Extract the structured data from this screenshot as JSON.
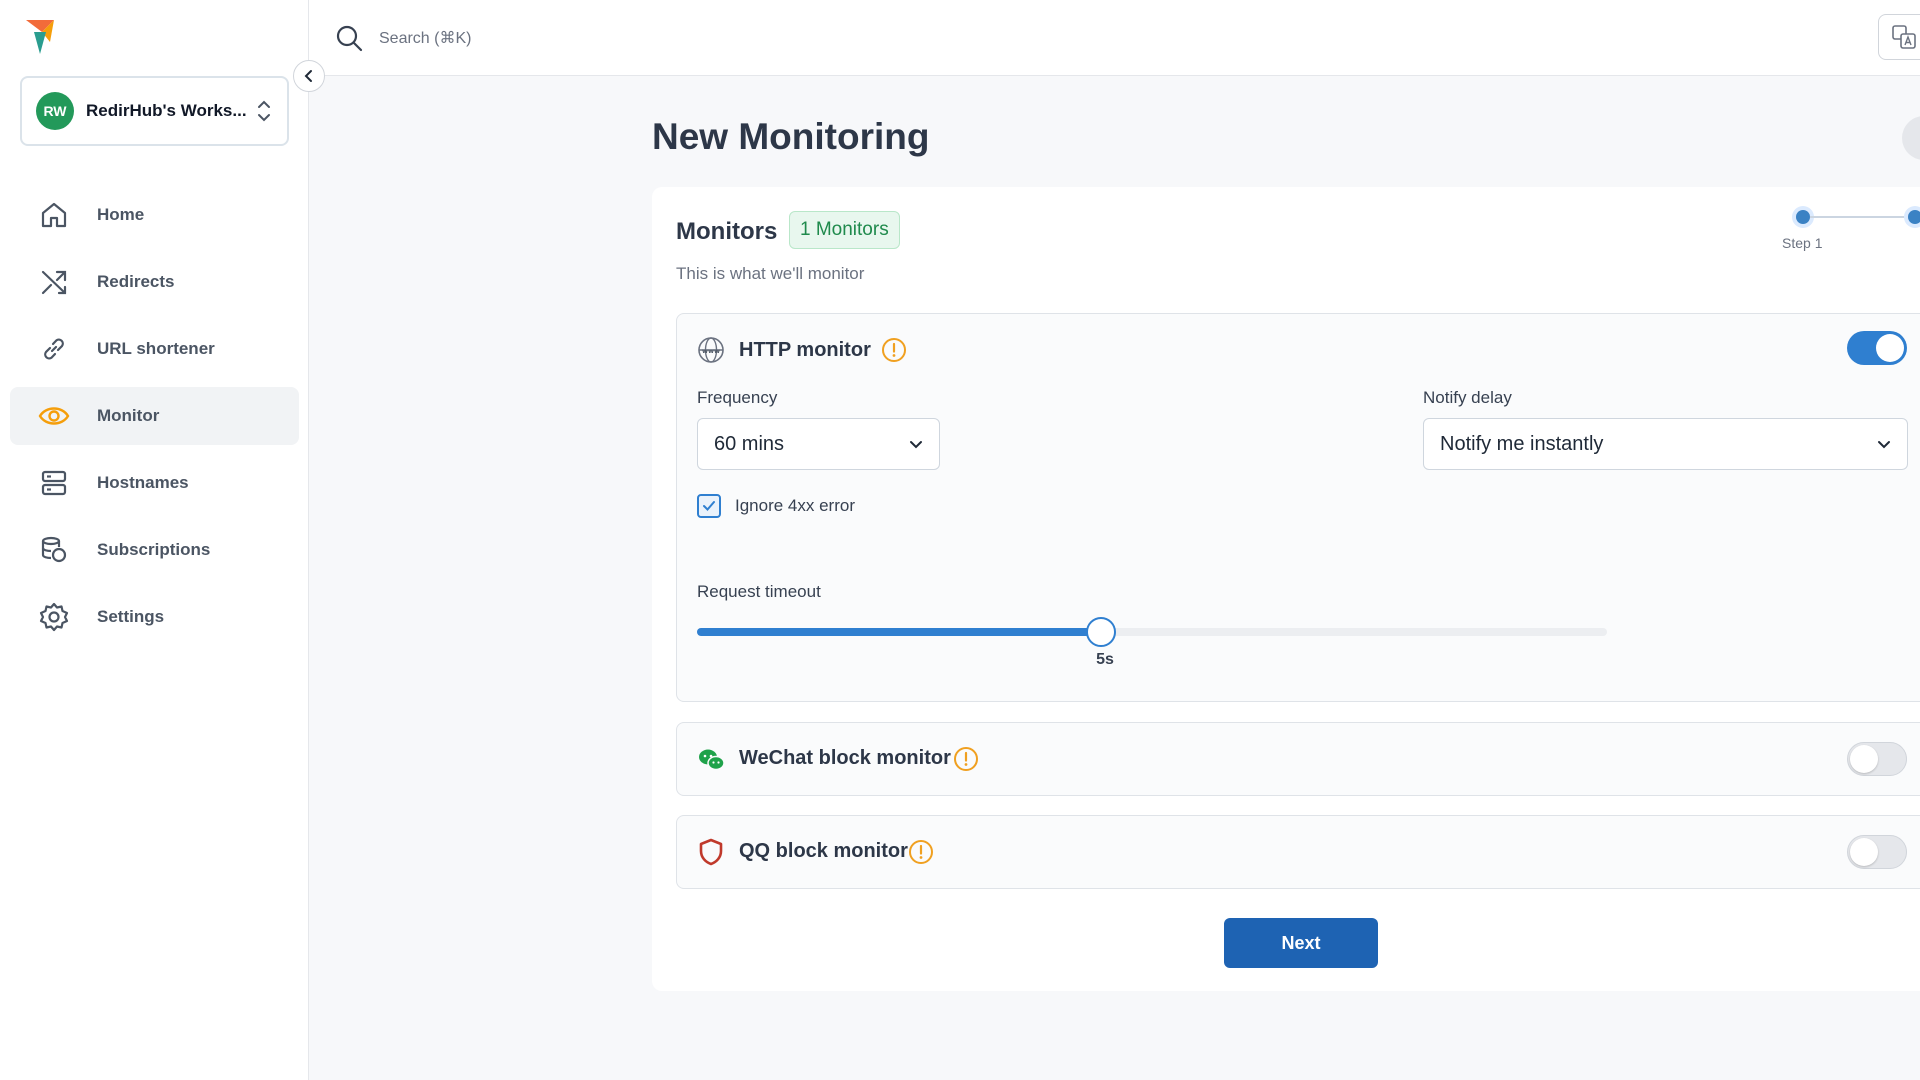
{
  "workspace": {
    "initials": "RW",
    "name": "RedirHub's Works..."
  },
  "nav": [
    {
      "label": "Home",
      "icon": "home-icon",
      "active": false
    },
    {
      "label": "Redirects",
      "icon": "shuffle-icon",
      "active": false
    },
    {
      "label": "URL shortener",
      "icon": "link-icon",
      "active": false
    },
    {
      "label": "Monitor",
      "icon": "eye-icon",
      "active": true
    },
    {
      "label": "Hostnames",
      "icon": "server-icon",
      "active": false
    },
    {
      "label": "Subscriptions",
      "icon": "coins-icon",
      "active": false
    },
    {
      "label": "Settings",
      "icon": "gear-icon",
      "active": false
    }
  ],
  "search": {
    "placeholder": "Search (⌘K)"
  },
  "page": {
    "title": "New Monitoring"
  },
  "monitors": {
    "title": "Monitors",
    "badge": "1 Monitors",
    "subtitle": "This is what we'll monitor"
  },
  "stepper": {
    "step1_label": "Step 1"
  },
  "http_monitor": {
    "title": "HTTP monitor",
    "enabled": true,
    "frequency_label": "Frequency",
    "frequency_value": "60 mins",
    "notify_label": "Notify delay",
    "notify_value": "Notify me instantly",
    "ignore_label": "Ignore 4xx error",
    "ignore_checked": true,
    "timeout_label": "Request timeout",
    "timeout_value": "5s",
    "timeout_fraction": 0.444
  },
  "wechat_monitor": {
    "title": "WeChat block monitor",
    "enabled": false
  },
  "qq_monitor": {
    "title": "QQ block monitor",
    "enabled": false
  },
  "actions": {
    "next_label": "Next"
  },
  "colors": {
    "accent": "#2f7fd0",
    "primary_button": "#1e63b3",
    "warning": "#f0a020",
    "active_nav_icon": "#f59e0b",
    "badge_green": "#1f8a4c"
  }
}
